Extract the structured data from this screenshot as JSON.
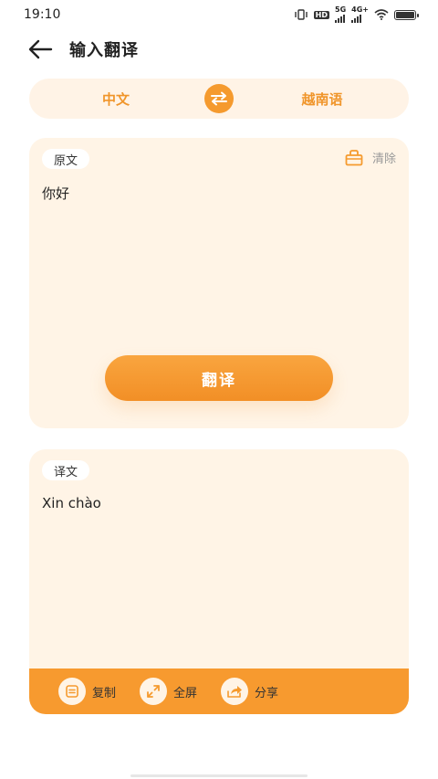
{
  "status_bar": {
    "time": "19:10",
    "hd_label": "HD",
    "net1_label": "5G",
    "net2_label": "4G+",
    "icons": [
      "vibrate-icon",
      "hd-icon",
      "signal-5g-icon",
      "signal-4g-icon",
      "wifi-icon",
      "battery-icon"
    ]
  },
  "header": {
    "title": "输入翻译",
    "back_icon": "arrow-left-icon"
  },
  "languages": {
    "source": "中文",
    "target": "越南语",
    "swap_icon": "swap-arrows-icon"
  },
  "source_card": {
    "chip_label": "原文",
    "clear_label": "清除",
    "clear_icon": "basket-icon",
    "text": "你好",
    "translate_button": "翻译"
  },
  "target_card": {
    "chip_label": "译文",
    "text": "Xin chào"
  },
  "actions": [
    {
      "label": "复制",
      "icon": "copy-icon"
    },
    {
      "label": "全屏",
      "icon": "fullscreen-icon"
    },
    {
      "label": "分享",
      "icon": "share-icon"
    }
  ],
  "colors": {
    "accent": "#f59a2e",
    "card_bg": "#fff4e6",
    "text": "#222222"
  }
}
